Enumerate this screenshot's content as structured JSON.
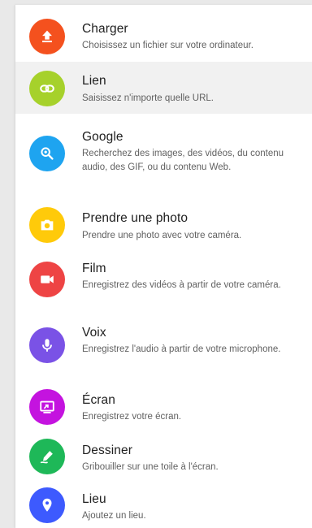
{
  "menu": {
    "items": [
      {
        "id": "charger",
        "title": "Charger",
        "description": "Choisissez un fichier sur votre ordinateur.",
        "icon": "upload-icon",
        "color": "#f4511e",
        "selected": false
      },
      {
        "id": "lien",
        "title": "Lien",
        "description": "Saisissez n'importe quelle URL.",
        "icon": "link-icon",
        "color": "#a6d12b",
        "selected": true
      },
      {
        "id": "google",
        "title": "Google",
        "description": "Recherchez des images, des vidéos, du contenu audio, des GIF, ou du contenu Web.",
        "icon": "google-search-icon",
        "color": "#1ea4f0",
        "selected": false
      },
      {
        "id": "photo",
        "title": "Prendre une photo",
        "description": "Prendre une photo avec votre caméra.",
        "icon": "camera-icon",
        "color": "#ffca0a",
        "selected": false
      },
      {
        "id": "film",
        "title": "Film",
        "description": "Enregistrez des vidéos à partir de votre caméra.",
        "icon": "video-camera-icon",
        "color": "#ee4444",
        "selected": false
      },
      {
        "id": "voix",
        "title": "Voix",
        "description": "Enregistrez l'audio à partir de votre microphone.",
        "icon": "microphone-icon",
        "color": "#7a52e6",
        "selected": false
      },
      {
        "id": "ecran",
        "title": "Écran",
        "description": "Enregistrez votre écran.",
        "icon": "screen-record-icon",
        "color": "#c413df",
        "selected": false
      },
      {
        "id": "dessiner",
        "title": "Dessiner",
        "description": "Gribouiller sur une toile à l'écran.",
        "icon": "draw-icon",
        "color": "#1eb858",
        "selected": false
      },
      {
        "id": "lieu",
        "title": "Lieu",
        "description": "Ajoutez un lieu.",
        "icon": "location-pin-icon",
        "color": "#3d5afe",
        "selected": false
      }
    ]
  }
}
